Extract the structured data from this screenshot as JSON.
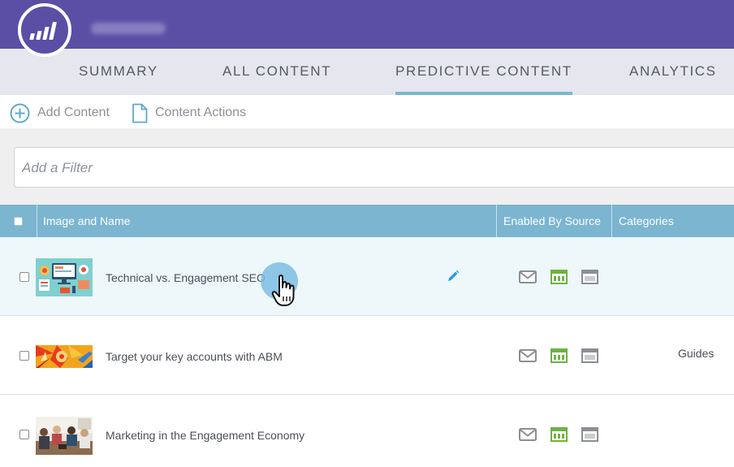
{
  "app": {
    "logo_icon": "marketo-bars-icon",
    "workspace_name": ""
  },
  "tabs": [
    {
      "label": "SUMMARY",
      "active": false
    },
    {
      "label": "ALL CONTENT",
      "active": false
    },
    {
      "label": "PREDICTIVE CONTENT",
      "active": true
    },
    {
      "label": "ANALYTICS",
      "active": false
    }
  ],
  "toolbar": {
    "add_label": "Add Content",
    "add_icon": "plus-circle-icon",
    "actions_label": "Content Actions",
    "actions_icon": "document-icon"
  },
  "filter": {
    "placeholder": "Add a Filter",
    "value": ""
  },
  "table": {
    "columns": [
      "Image and Name",
      "Enabled By Source",
      "Categories"
    ],
    "rows": [
      {
        "name": "Technical vs. Engagement SEO",
        "category": "",
        "thumbnail": "seo-illustration",
        "hovered": true
      },
      {
        "name": "Target your key accounts with ABM",
        "category": "Guides",
        "thumbnail": "abm-target-image",
        "hovered": false
      },
      {
        "name": "Marketing in the Engagement Economy",
        "category": "",
        "thumbnail": "meeting-photo",
        "hovered": false
      }
    ],
    "source_icons": [
      "email-icon",
      "web-page-icon",
      "rich-media-icon"
    ]
  },
  "colors": {
    "topbar": "#5a4fa5",
    "tabs_bg": "#e6e6ee",
    "tab_active_underline": "#7ab7cf",
    "table_header": "#7bb5d0",
    "row_highlight": "#eef8fb",
    "web_icon_green": "#6db33f",
    "edit_pencil": "#2a9fd6"
  }
}
